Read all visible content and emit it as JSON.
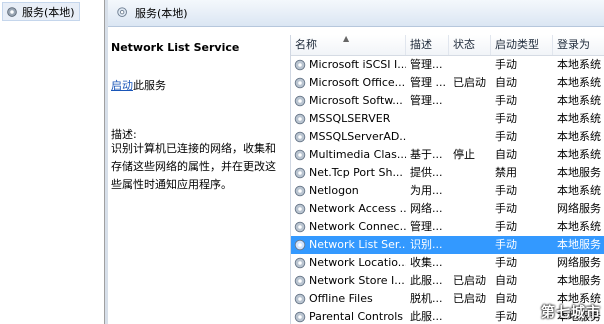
{
  "tree": {
    "item_label": "服务(本地)"
  },
  "header": {
    "title": "服务(本地)"
  },
  "detail": {
    "service_name": "Network List Service",
    "start_link": "启动",
    "start_suffix": "此服务",
    "desc_label": "描述:",
    "desc_text": "识别计算机已连接的网络，收集和存储这些网络的属性，并在更改这些属性时通知应用程序。"
  },
  "table": {
    "columns": [
      "名称",
      "描述",
      "状态",
      "启动类型",
      "登录为"
    ],
    "rows": [
      {
        "name": "Microsoft iSCSI I...",
        "desc": "管理...",
        "status": "",
        "startup": "手动",
        "login": "本地系统",
        "selected": false
      },
      {
        "name": "Microsoft Office...",
        "desc": "管理 ...",
        "status": "已启动",
        "startup": "自动",
        "login": "本地系统",
        "selected": false
      },
      {
        "name": "Microsoft Softw...",
        "desc": "管理...",
        "status": "",
        "startup": "手动",
        "login": "本地系统",
        "selected": false
      },
      {
        "name": "MSSQLSERVER",
        "desc": "",
        "status": "",
        "startup": "手动",
        "login": "本地系统",
        "selected": false
      },
      {
        "name": "MSSQLServerAD...",
        "desc": "",
        "status": "",
        "startup": "手动",
        "login": "本地系统",
        "selected": false
      },
      {
        "name": "Multimedia Clas...",
        "desc": "基于...",
        "status": "停止",
        "startup": "自动",
        "login": "本地系统",
        "selected": false
      },
      {
        "name": "Net.Tcp Port Sh...",
        "desc": "提供...",
        "status": "",
        "startup": "禁用",
        "login": "本地服务",
        "selected": false
      },
      {
        "name": "Netlogon",
        "desc": "为用...",
        "status": "",
        "startup": "手动",
        "login": "本地系统",
        "selected": false
      },
      {
        "name": "Network Access ...",
        "desc": "网络...",
        "status": "",
        "startup": "手动",
        "login": "网络服务",
        "selected": false
      },
      {
        "name": "Network Connec...",
        "desc": "管理...",
        "status": "",
        "startup": "手动",
        "login": "本地系统",
        "selected": false
      },
      {
        "name": "Network List Ser...",
        "desc": "识别...",
        "status": "",
        "startup": "手动",
        "login": "本地服务",
        "selected": true
      },
      {
        "name": "Network Locatio...",
        "desc": "收集...",
        "status": "",
        "startup": "手动",
        "login": "网络服务",
        "selected": false
      },
      {
        "name": "Network Store I...",
        "desc": "此服...",
        "status": "已启动",
        "startup": "自动",
        "login": "本地服务",
        "selected": false
      },
      {
        "name": "Offline Files",
        "desc": "脱机...",
        "status": "已启动",
        "startup": "自动",
        "login": "本地系统",
        "selected": false
      },
      {
        "name": "Parental Controls",
        "desc": "此服...",
        "status": "",
        "startup": "手动",
        "login": "本地服务",
        "selected": false
      }
    ]
  },
  "watermark": "第七城市",
  "colors": {
    "selection": "#3399ff",
    "link": "#1a56b8"
  },
  "icons": {
    "row": "gear-icon",
    "header": "services-icon"
  }
}
